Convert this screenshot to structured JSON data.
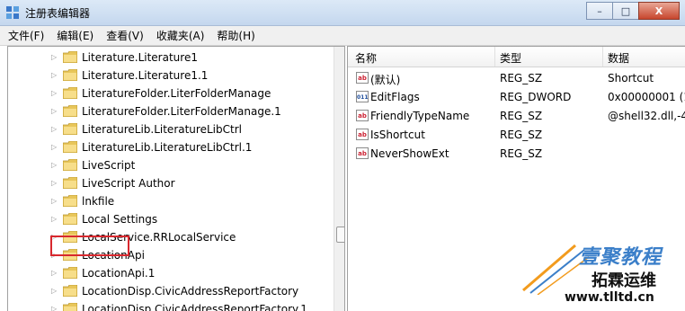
{
  "window": {
    "title": "注册表编辑器",
    "buttons": [
      "–",
      "□",
      "X"
    ]
  },
  "menu": [
    "文件(F)",
    "编辑(E)",
    "查看(V)",
    "收藏夹(A)",
    "帮助(H)"
  ],
  "tree": {
    "items": [
      "Literature.Literature1",
      "Literature.Literature1.1",
      "LiteratureFolder.LiterFolderManage",
      "LiteratureFolder.LiterFolderManage.1",
      "LiteratureLib.LiteratureLibCtrl",
      "LiteratureLib.LiteratureLibCtrl.1",
      "LiveScript",
      "LiveScript Author",
      "lnkfile",
      "Local Settings",
      "LocalService.RRLocalService",
      "LocationApi",
      "LocationApi.1",
      "LocationDisp.CivicAddressReportFactory",
      "LocationDisp.CivicAddressReportFactory.1"
    ],
    "selected": "lnkfile"
  },
  "values": {
    "headers": [
      "名称",
      "类型",
      "数据"
    ],
    "rows": [
      {
        "name": "(默认)",
        "type": "REG_SZ",
        "data": "Shortcut",
        "icon": "string-value-icon"
      },
      {
        "name": "EditFlags",
        "type": "REG_DWORD",
        "data": "0x00000001 (1",
        "icon": "binary-value-icon"
      },
      {
        "name": "FriendlyTypeName",
        "type": "REG_SZ",
        "data": "@shell32.dll,-4",
        "icon": "string-value-icon"
      },
      {
        "name": "IsShortcut",
        "type": "REG_SZ",
        "data": "",
        "icon": "string-value-icon"
      },
      {
        "name": "NeverShowExt",
        "type": "REG_SZ",
        "data": "",
        "icon": "string-value-icon"
      }
    ]
  },
  "watermark": {
    "line1": "壹聚教程",
    "line2": "拓霖运维",
    "line3": "www.tlltd.cn"
  },
  "colors": {
    "highlight_border": "#d8282e",
    "folder": "#e8c65a",
    "title_gradient_top": "#dce9f7"
  }
}
